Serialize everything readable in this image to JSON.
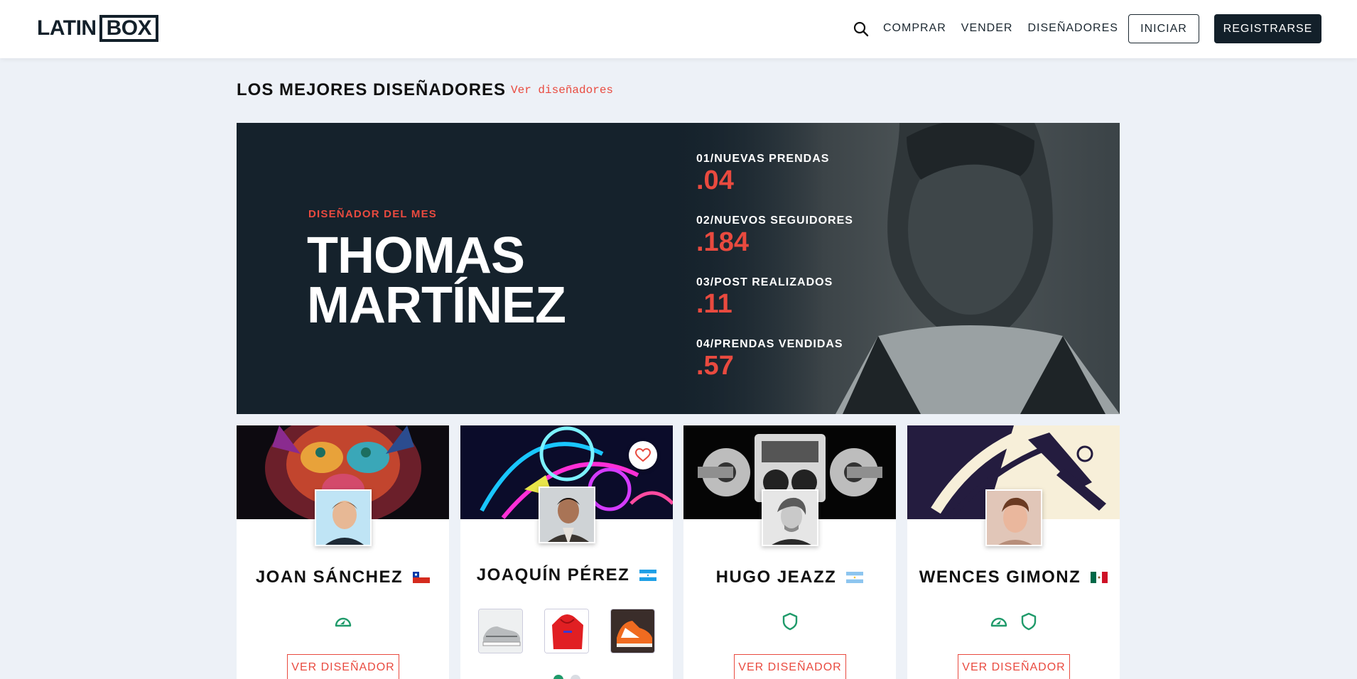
{
  "nav": {
    "logo_a": "LATIN",
    "logo_b": "BOX",
    "links": [
      "COMPRAR",
      "VENDER",
      "DISEÑADORES"
    ],
    "login": "INICIAR",
    "register": "REGISTRARSE"
  },
  "section": {
    "title": "LOS MEJORES DISEÑADORES",
    "link": "Ver diseñadores"
  },
  "hero": {
    "subtitle": "DISEÑADOR DEL MES",
    "name_line1": "THOMAS",
    "name_line2": "MARTÍNEZ",
    "stats": [
      {
        "label": "01/NUEVAS PRENDAS",
        "value": ".04"
      },
      {
        "label": "02/NUEVOS SEGUIDORES",
        "value": ".184"
      },
      {
        "label": "03/POST REALIZADOS",
        "value": ".11"
      },
      {
        "label": "04/PRENDAS VENDIDAS",
        "value": ".57"
      }
    ]
  },
  "cards": [
    {
      "name": "JOAN SÁNCHEZ",
      "flag": "chile-flag",
      "badges": [
        "speedometer-icon"
      ],
      "button": "VER DISEÑADOR"
    },
    {
      "name": "JOAQUÍN PÉREZ",
      "flag": "honduras-flag",
      "products": [
        "sneaker-gray",
        "red-hoodie",
        "sneaker-orange"
      ],
      "favorite": true
    },
    {
      "name": "HUGO JEAZZ",
      "flag": "argentina-flag",
      "badges": [
        "shield-icon"
      ],
      "button": "VER DISEÑADOR"
    },
    {
      "name": "WENCES GIMONZ",
      "flag": "mexico-flag",
      "badges": [
        "speedometer-icon",
        "shield-icon"
      ],
      "button": "VER DISEÑADOR"
    }
  ],
  "colors": {
    "accent": "#e94a3f",
    "dark": "#13202a",
    "badge_green": "#1f9a6a",
    "background": "#edf1f7"
  }
}
